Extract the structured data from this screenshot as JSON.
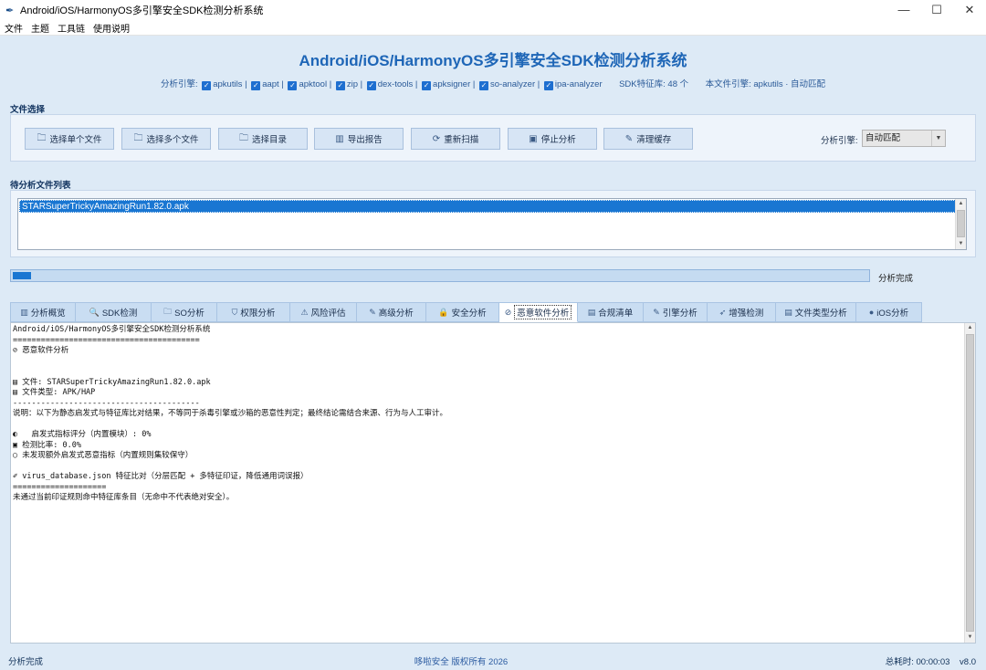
{
  "window": {
    "title": "Android/iOS/HarmonyOS多引擎安全SDK检测分析系统",
    "minimize": "—",
    "maximize": "☐",
    "close": "✕"
  },
  "menu": [
    "文件",
    "主题",
    "工具链",
    "使用说明"
  ],
  "app_title": "Android/iOS/HarmonyOS多引擎安全SDK检测分析系统",
  "engines": {
    "label": "分析引擎:",
    "items": [
      "apkutils",
      "aapt",
      "apktool",
      "zip",
      "dex-tools",
      "apksigner",
      "so-analyzer",
      "ipa-analyzer"
    ],
    "sdk_count": "SDK特征库: 48 个",
    "current": "本文件引擎: apkutils · 自动匹配"
  },
  "file_select": {
    "title": "文件选择",
    "buttons": [
      "选择单个文件",
      "选择多个文件",
      "选择目录",
      "导出报告",
      "重新扫描",
      "停止分析",
      "清理缓存"
    ],
    "engine_label": "分析引擎:",
    "engine_value": "自动匹配"
  },
  "file_list": {
    "title": "待分析文件列表",
    "items": [
      "STARSuperTrickyAmazingRun1.82.0.apk"
    ]
  },
  "progress": {
    "value": 0.025,
    "text": "分析完成"
  },
  "tabs": [
    {
      "label": "分析概览",
      "icon": "chart-icon"
    },
    {
      "label": "SDK检测",
      "icon": "search-icon"
    },
    {
      "label": "SO分析",
      "icon": "folder-icon"
    },
    {
      "label": "权限分析",
      "icon": "shield-icon"
    },
    {
      "label": "风险评估",
      "icon": "warning-icon"
    },
    {
      "label": "高级分析",
      "icon": "pencil-icon"
    },
    {
      "label": "安全分析",
      "icon": "lock-icon"
    },
    {
      "label": "恶意软件分析",
      "icon": "link-icon"
    },
    {
      "label": "合规清单",
      "icon": "document-icon"
    },
    {
      "label": "引擎分析",
      "icon": "pencil-icon"
    },
    {
      "label": "增强检测",
      "icon": "rocket-icon"
    },
    {
      "label": "文件类型分析",
      "icon": "document-icon"
    },
    {
      "label": "iOS分析",
      "icon": "apple-icon"
    }
  ],
  "active_tab": 7,
  "output_lines": [
    "Android/iOS/HarmonyOS多引擎安全SDK检测分析系统",
    "========================================",
    "⊘ 恶意软件分析",
    "",
    "",
    "▤ 文件: STARSuperTrickyAmazingRun1.82.0.apk",
    "▤ 文件类型: APK/HAP",
    "----------------------------------------",
    "说明：以下为静态启发式与特征库比对结果，不等同于杀毒引擎或沙箱的恶意性判定；最终结论需结合来源、行为与人工审计。",
    "",
    "◐   启发式指标评分（内置模块）: 0%",
    "▣ 检测比率: 0.0%",
    "◯ 未发现额外启发式恶意指标（内置规则集较保守）",
    "",
    "✐ virus_database.json 特征比对（分层匹配 + 多特征印证，降低通用词误报）",
    "====================",
    "未通过当前印证规则命中特征库条目（无命中不代表绝对安全）。"
  ],
  "status": {
    "left": "分析完成",
    "center": "哆啦安全 版权所有 2026",
    "time": "总耗时: 00:00:03",
    "version": "v8.0"
  }
}
